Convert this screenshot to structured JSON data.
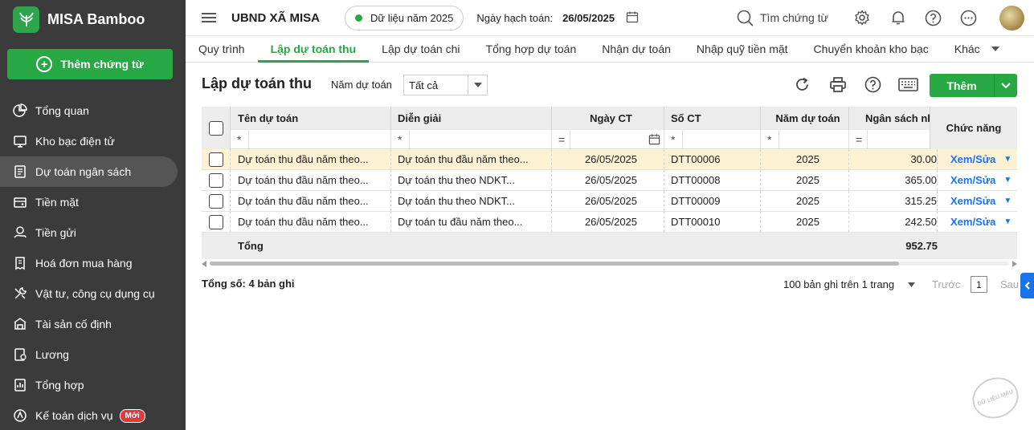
{
  "app": {
    "name": "MISA Bamboo",
    "new_voucher": "Thêm chứng từ"
  },
  "sidebar": {
    "items": [
      {
        "label": "Tổng quan",
        "icon": "pie-chart-icon"
      },
      {
        "label": "Kho bạc điện tử",
        "icon": "monitor-icon"
      },
      {
        "label": "Dự toán ngân sách",
        "icon": "budget-icon",
        "active": true
      },
      {
        "label": "Tiền mặt",
        "icon": "cash-icon"
      },
      {
        "label": "Tiền gửi",
        "icon": "deposit-icon"
      },
      {
        "label": "Hoá đơn mua hàng",
        "icon": "invoice-icon"
      },
      {
        "label": "Vật tư, công cụ dụng cụ",
        "icon": "tools-icon"
      },
      {
        "label": "Tài sản cố định",
        "icon": "building-icon"
      },
      {
        "label": "Lương",
        "icon": "salary-icon"
      },
      {
        "label": "Tổng hợp",
        "icon": "report-icon"
      },
      {
        "label": "Kế toán dịch vụ",
        "icon": "service-icon",
        "badge": "Mới"
      }
    ]
  },
  "header": {
    "org": "UBND XÃ MISA",
    "data_year": "Dữ liệu năm 2025",
    "posting_label": "Ngày hạch toán:",
    "posting_date": "26/05/2025",
    "search": "Tìm chứng từ"
  },
  "tabs": [
    {
      "label": "Quy trình"
    },
    {
      "label": "Lập dự toán thu",
      "active": true
    },
    {
      "label": "Lập dự toán chi"
    },
    {
      "label": "Tổng hợp dự toán"
    },
    {
      "label": "Nhận dự toán"
    },
    {
      "label": "Nhập quỹ tiền mặt"
    },
    {
      "label": "Chuyển khoản kho bạc"
    },
    {
      "label": "Khác"
    }
  ],
  "toolbar": {
    "title": "Lập dự toán thu",
    "year_label": "Năm dự toán",
    "year_value": "Tất cả",
    "add_label": "Thêm"
  },
  "grid": {
    "columns": [
      "Tên dự toán",
      "Diễn giải",
      "Ngày CT",
      "Số CT",
      "Năm dự toán",
      "Ngân sách nhà",
      "Chức năng"
    ],
    "filter_ops": [
      "*",
      "*",
      "=",
      "*",
      "*",
      "="
    ],
    "rows": [
      {
        "name": "Dự toán thu đầu năm theo...",
        "desc": "Dự toán thu đầu năm theo...",
        "date": "26/05/2025",
        "no": "DTT00006",
        "year": "2025",
        "amount": "30.00",
        "action": "Xem/Sửa"
      },
      {
        "name": "Dự toán thu đầu năm theo...",
        "desc": "Dự toán thu theo NDKT...",
        "date": "26/05/2025",
        "no": "DTT00008",
        "year": "2025",
        "amount": "365.00",
        "action": "Xem/Sửa"
      },
      {
        "name": "Dự toán thu đầu năm theo...",
        "desc": "Dự toán thu theo NDKT...",
        "date": "26/05/2025",
        "no": "DTT00009",
        "year": "2025",
        "amount": "315.25",
        "action": "Xem/Sửa"
      },
      {
        "name": "Dự toán thu đầu năm theo...",
        "desc": "Dự toán tu đầu năm theo...",
        "date": "26/05/2025",
        "no": "DTT00010",
        "year": "2025",
        "amount": "242.50",
        "action": "Xem/Sửa"
      }
    ],
    "total_label": "Tổng",
    "total_amount": "952.75"
  },
  "footer": {
    "count": "Tổng số: 4 bản ghi",
    "page_size": "100 bản ghi trên 1 trang",
    "prev": "Trước",
    "page": "1",
    "next": "Sau"
  },
  "stamp": "DỮ LIỆU MẪU"
}
